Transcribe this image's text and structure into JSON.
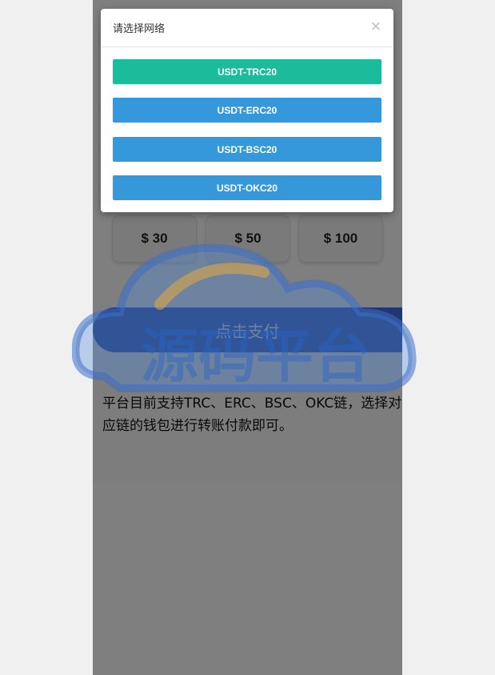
{
  "amounts": [
    "$ 30",
    "$ 50",
    "$ 100"
  ],
  "pay_button": "点击支付",
  "notice": "平台目前支持TRC、ERC、BSC、OKC链，选择对应链的钱包进行转账付款即可。",
  "modal": {
    "title": "请选择网络",
    "close": "×",
    "networks": [
      {
        "label": "USDT-TRC20",
        "color": "#1abc9c"
      },
      {
        "label": "USDT-ERC20",
        "color": "#3498db"
      },
      {
        "label": "USDT-BSC20",
        "color": "#3498db"
      },
      {
        "label": "USDT-OKC20",
        "color": "#3498db"
      }
    ]
  },
  "watermark": {
    "text": "源码平台"
  }
}
